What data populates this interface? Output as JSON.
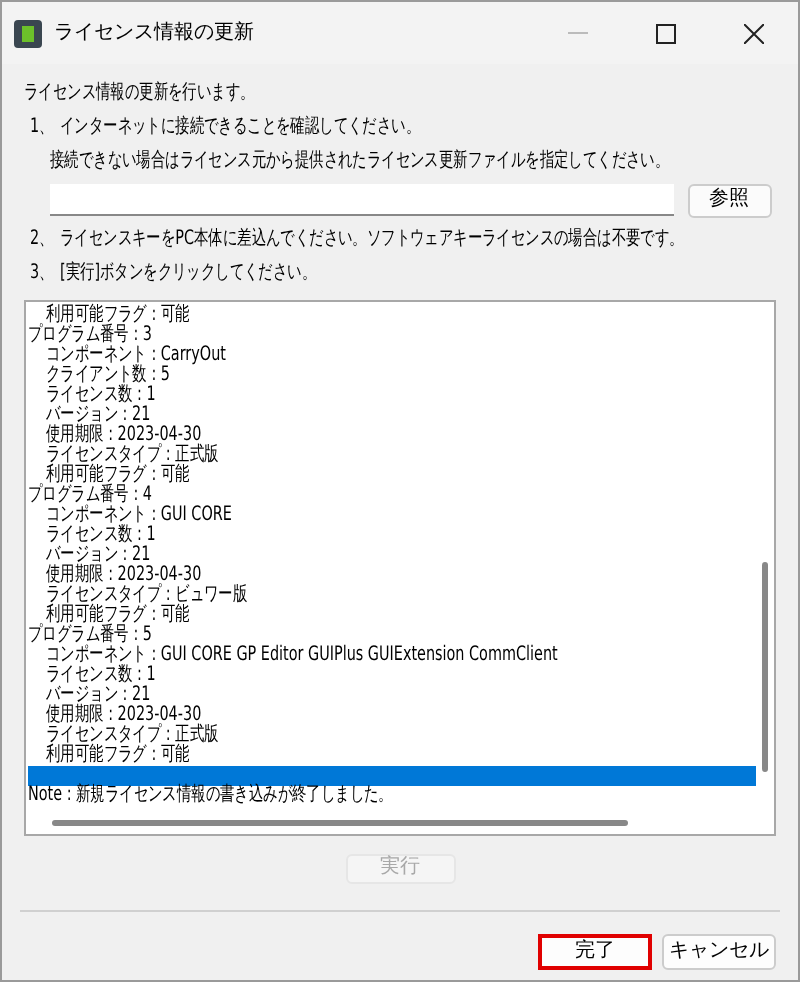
{
  "window": {
    "title": "ライセンス情報の更新"
  },
  "intro": "ライセンス情報の更新を行います。",
  "steps": [
    {
      "number": "1、",
      "text": "インターネットに接続できることを確認してください。",
      "note": "接続できない場合はライセンス元から提供されたライセンス更新ファイルを指定してください。"
    },
    {
      "number": "2、",
      "text": "ライセンスキーをPC本体に差込んでください。ソフトウェアキーライセンスの場合は不要です。"
    },
    {
      "number": "3、",
      "text": "[実行]ボタンをクリックしてください。"
    }
  ],
  "file_field": {
    "browse_button": "参照"
  },
  "log": [
    {
      "kind": "group",
      "children": [
        {
          "text": "利用可能フラグ : 可能"
        }
      ]
    },
    {
      "kind": "group",
      "text": "プログラム番号 : 3",
      "children": [
        {
          "text": "コンポーネント : CarryOut"
        },
        {
          "text": "クライアント数 : 5"
        },
        {
          "text": "ライセンス数 : 1"
        },
        {
          "text": "バージョン : 21"
        },
        {
          "text": "使用期限 : 2023-04-30"
        },
        {
          "text": "ライセンスタイプ : 正式版"
        },
        {
          "text": "利用可能フラグ : 可能"
        }
      ]
    },
    {
      "kind": "group",
      "text": "プログラム番号 : 4",
      "children": [
        {
          "text": "コンポーネント : GUI  CORE"
        },
        {
          "text": "ライセンス数 : 1"
        },
        {
          "text": "バージョン : 21"
        },
        {
          "text": "使用期限 : 2023-04-30"
        },
        {
          "text": "ライセンスタイプ : ビュワー版"
        },
        {
          "text": "利用可能フラグ : 可能"
        }
      ]
    },
    {
      "kind": "group",
      "text": "プログラム番号 : 5",
      "children": [
        {
          "text": "コンポーネント : GUI  CORE  GP  Editor  GUIPlus  GUIExtension  CommClient"
        },
        {
          "text": "ライセンス数 : 1"
        },
        {
          "text": "バージョン : 21"
        },
        {
          "text": "使用期限 : 2023-04-30"
        },
        {
          "text": "ライセンスタイプ : 正式版"
        },
        {
          "text": "利用可能フラグ : 可能"
        }
      ]
    },
    {
      "kind": "blank",
      "selected": true
    },
    {
      "kind": "line",
      "text": "Note : 新規ライセンス情報の書き込みが終了しました。",
      "selected": false
    }
  ],
  "execute_button": {
    "label": "実行",
    "disabled": true
  },
  "buttons": [
    {
      "label": "完了",
      "focused": true
    },
    {
      "label": "キャンセル",
      "focused": false
    }
  ]
}
